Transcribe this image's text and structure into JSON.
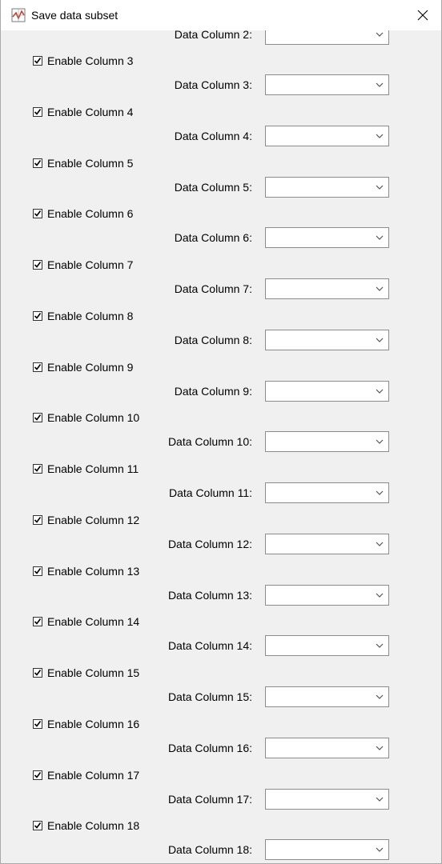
{
  "window": {
    "title": "Save data subset",
    "icons": {
      "app": "matlab-figure-icon",
      "close": "close-icon"
    }
  },
  "partial_row": {
    "data_label": "Data Column 2:",
    "dropdown_value": ""
  },
  "rows": [
    {
      "enable_label": "Enable Column 3",
      "checked": true,
      "data_label": "Data Column 3:",
      "dropdown_value": ""
    },
    {
      "enable_label": "Enable Column 4",
      "checked": true,
      "data_label": "Data Column 4:",
      "dropdown_value": ""
    },
    {
      "enable_label": "Enable Column 5",
      "checked": true,
      "data_label": "Data Column 5:",
      "dropdown_value": ""
    },
    {
      "enable_label": "Enable Column 6",
      "checked": true,
      "data_label": "Data Column 6:",
      "dropdown_value": ""
    },
    {
      "enable_label": "Enable Column 7",
      "checked": true,
      "data_label": "Data Column 7:",
      "dropdown_value": ""
    },
    {
      "enable_label": "Enable Column 8",
      "checked": true,
      "data_label": "Data Column 8:",
      "dropdown_value": ""
    },
    {
      "enable_label": "Enable Column 9",
      "checked": true,
      "data_label": "Data Column 9:",
      "dropdown_value": ""
    },
    {
      "enable_label": "Enable Column 10",
      "checked": true,
      "data_label": "Data Column 10:",
      "dropdown_value": ""
    },
    {
      "enable_label": "Enable Column 11",
      "checked": true,
      "data_label": "Data Column 11:",
      "dropdown_value": ""
    },
    {
      "enable_label": "Enable Column 12",
      "checked": true,
      "data_label": "Data Column 12:",
      "dropdown_value": ""
    },
    {
      "enable_label": "Enable Column 13",
      "checked": true,
      "data_label": "Data Column 13:",
      "dropdown_value": ""
    },
    {
      "enable_label": "Enable Column 14",
      "checked": true,
      "data_label": "Data Column 14:",
      "dropdown_value": ""
    },
    {
      "enable_label": "Enable Column 15",
      "checked": true,
      "data_label": "Data Column 15:",
      "dropdown_value": ""
    },
    {
      "enable_label": "Enable Column 16",
      "checked": true,
      "data_label": "Data Column 16:",
      "dropdown_value": ""
    },
    {
      "enable_label": "Enable Column 17",
      "checked": true,
      "data_label": "Data Column 17:",
      "dropdown_value": ""
    },
    {
      "enable_label": "Enable Column 18",
      "checked": true,
      "data_label": "Data Column 18:",
      "dropdown_value": ""
    }
  ]
}
